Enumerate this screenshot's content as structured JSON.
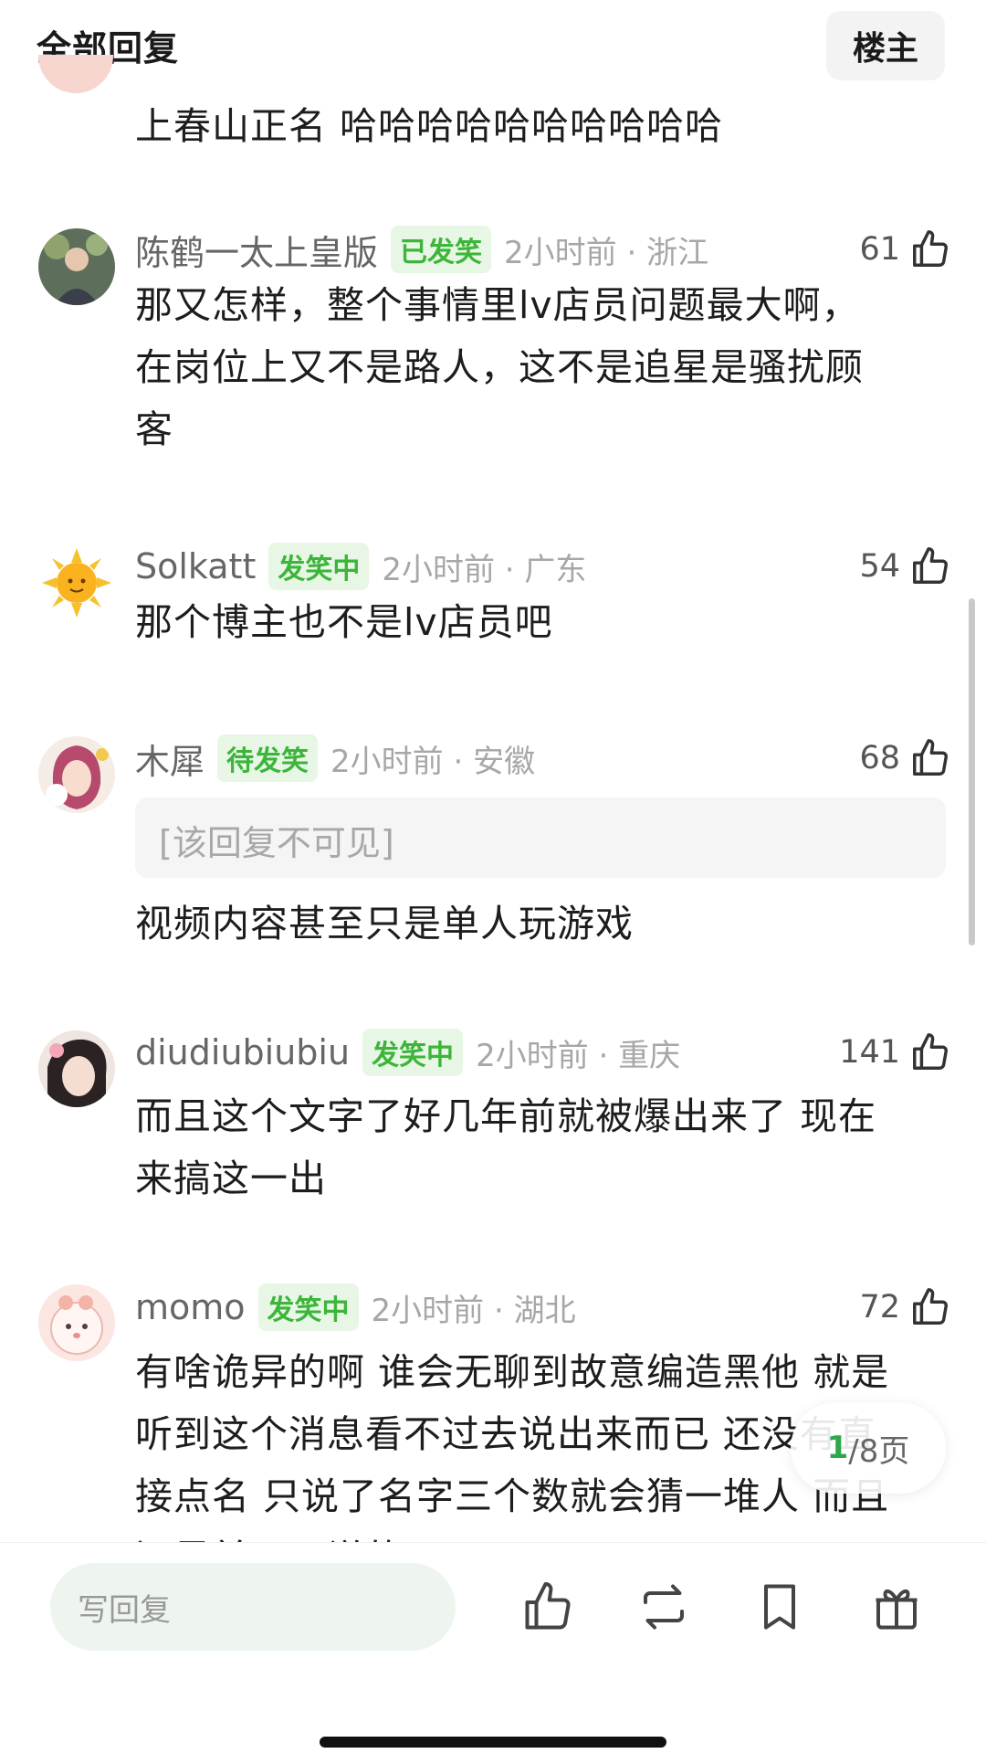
{
  "header": {
    "title": "全部回复",
    "op_button": "楼主"
  },
  "partial_comment": {
    "text": "上春山正名  哈哈哈哈哈哈哈哈哈哈"
  },
  "comments": [
    {
      "name": "陈鹤一太上皇版",
      "badge": "已发笑",
      "time": "2小时前 · 浙江",
      "likes": "61",
      "lines": [
        "那又怎样，整个事情里lv店员问题最大啊，",
        "在岗位上又不是路人，这不是追星是骚扰顾",
        "客"
      ]
    },
    {
      "name": "Solkatt",
      "badge": "发笑中",
      "time": "2小时前 · 广东",
      "likes": "54",
      "lines": [
        "那个博主也不是lv店员吧"
      ]
    },
    {
      "name": "木犀",
      "badge": "待发笑",
      "time": "2小时前 · 安徽",
      "likes": "68",
      "hidden_text": "[该回复不可见]",
      "lines": [
        "视频内容甚至只是单人玩游戏"
      ]
    },
    {
      "name": "diudiubiubiu",
      "badge": "发笑中",
      "time": "2小时前 · 重庆",
      "likes": "141",
      "lines": [
        "而且这个文字了好几年前就被爆出来了 现在",
        "来搞这一出"
      ]
    },
    {
      "name": "momo",
      "badge": "发笑中",
      "time": "2小时前 · 湖北",
      "likes": "72",
      "lines": [
        "有啥诡异的啊 谁会无聊到故意编造黑他 就是",
        "听到这个消息看不过去说出来而已 还没有直",
        "接点名 只说了名字三个数就会猜一堆人 而且",
        "还是前几天说的"
      ]
    }
  ],
  "pager": {
    "current": "1",
    "rest": "/8页"
  },
  "bottom_bar": {
    "reply_placeholder": "写回复"
  },
  "icons": {
    "thumb": "thumbs-up-icon",
    "repost": "repost-icon",
    "bookmark": "bookmark-icon",
    "gift": "gift-icon"
  },
  "colors": {
    "badge_green": "#3cb53a",
    "badge_bg": "#e8f7e5",
    "input_bg": "#eef5ef",
    "pager_green": "#2ea84a"
  }
}
